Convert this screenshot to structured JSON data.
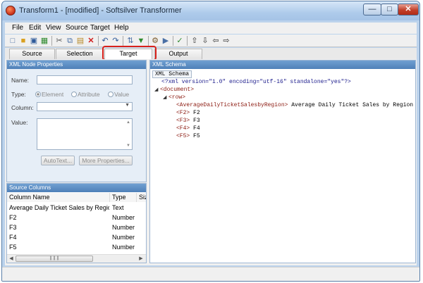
{
  "window": {
    "title": "Transform1 - [modified] - Softsilver Transformer"
  },
  "menu": [
    "File",
    "Edit",
    "View",
    "Source",
    "Target",
    "Help"
  ],
  "tabs": [
    "Source",
    "Selection",
    "Target",
    "Output"
  ],
  "node_panel": {
    "header": "XML Node Properties",
    "name_label": "Name:",
    "type_label": "Type:",
    "type_options": [
      "Element",
      "Attribute",
      "Value"
    ],
    "type_selected": "Element",
    "column_label": "Column:",
    "value_label": "Value:",
    "autotext_label": "AutoText...",
    "more_props_label": "More Properties..."
  },
  "source_panel": {
    "header": "Source Columns",
    "columns": [
      "Column Name",
      "Type",
      "Size"
    ],
    "rows": [
      {
        "name": "Average Daily Ticket Sales by Region",
        "type": "Text"
      },
      {
        "name": "F2",
        "type": "Number"
      },
      {
        "name": "F3",
        "type": "Number"
      },
      {
        "name": "F4",
        "type": "Number"
      },
      {
        "name": "F5",
        "type": "Number"
      }
    ]
  },
  "schema_panel": {
    "header": "XML Schema",
    "tab": "XML Schema",
    "declaration": "<?xml version=\"1.0\" encoding=\"utf-16\" standalone=\"yes\"?>",
    "document_tag": "<document>",
    "row_tag": "<row>",
    "children": [
      {
        "tag": "<AverageDailyTicketSalesbyRegion>",
        "text": "Average Daily Ticket Sales by Region"
      },
      {
        "tag": "<F2>",
        "text": "F2"
      },
      {
        "tag": "<F3>",
        "text": "F3"
      },
      {
        "tag": "<F4>",
        "text": "F4"
      },
      {
        "tag": "<F5>",
        "text": "F5"
      }
    ]
  },
  "colors": {
    "highlight": "#d9221b",
    "panel_header": "#5b8cc4",
    "xml_tag": "#8b1a10"
  }
}
